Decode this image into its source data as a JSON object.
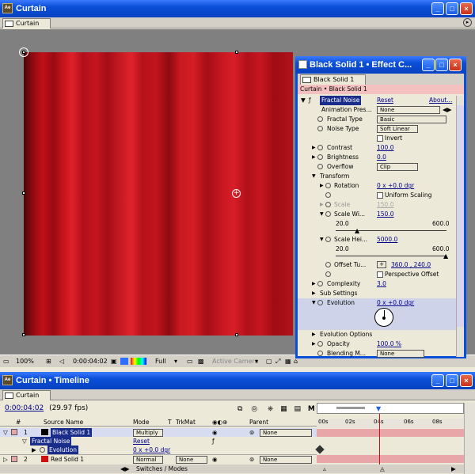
{
  "app": {
    "title": "Curtain",
    "tab": "Curtain"
  },
  "colors": {
    "titlebar": "#0a4fd8",
    "solid": "#c01018",
    "layer_bar": "#e8a6a8"
  },
  "comp_footer": {
    "zoom": "100%",
    "timecode": "0:00:04:02",
    "resolution": "Full",
    "camera": "Active Camera"
  },
  "effect_panel": {
    "title": "Black Solid 1 • Effect C...",
    "tab": "Black Solid 1",
    "breadcrumb": "Curtain • Black Solid 1",
    "effect_name": "Fractal Noise",
    "reset": "Reset",
    "about": "About...",
    "rows": [
      {
        "label": "Animation Pres...",
        "value": "None",
        "kind": "dropdown"
      },
      {
        "label": "Fractal Type",
        "value": "Basic",
        "kind": "dropdown"
      },
      {
        "label": "Noise Type",
        "value": "Soft Linear",
        "kind": "dropdown"
      },
      {
        "label": "",
        "value": "Invert",
        "kind": "check"
      },
      {
        "label": "Contrast",
        "value": "100.0",
        "kind": "num"
      },
      {
        "label": "Brightness",
        "value": "0.0",
        "kind": "num"
      },
      {
        "label": "Overflow",
        "value": "Clip",
        "kind": "dropdown"
      },
      {
        "label": "Transform",
        "value": "",
        "kind": "group"
      },
      {
        "label": "Rotation",
        "value": "0 x +0.0 dgr",
        "kind": "num"
      },
      {
        "label": "",
        "value": "Uniform Scaling",
        "kind": "check"
      },
      {
        "label": "Scale",
        "value": "150.0",
        "kind": "disabled"
      },
      {
        "label": "Scale Wi...",
        "value": "150.0",
        "kind": "num"
      },
      {
        "label": "Scale Hei...",
        "value": "5000.0",
        "kind": "num"
      },
      {
        "label": "Offset Tu...",
        "value": "360.0 , 240.0",
        "kind": "num"
      },
      {
        "label": "",
        "value": "Perspective Offset",
        "kind": "check"
      },
      {
        "label": "Complexity",
        "value": "3.0",
        "kind": "num"
      },
      {
        "label": "Sub Settings",
        "value": "",
        "kind": "group"
      },
      {
        "label": "Evolution",
        "value": "0 x +0.0 dgr",
        "kind": "num"
      },
      {
        "label": "Evolution Options",
        "value": "",
        "kind": "group"
      },
      {
        "label": "Opacity",
        "value": "100.0 %",
        "kind": "num"
      },
      {
        "label": "Blending M...",
        "value": "None",
        "kind": "dropdown"
      }
    ],
    "slider_w": {
      "min": "20.0",
      "max": "600.0",
      "level": 0.2
    },
    "slider_h": {
      "min": "20.0",
      "max": "600.0",
      "level": 1.0
    }
  },
  "timeline": {
    "title": "Curtain • Timeline",
    "tab": "Curtain",
    "time": "0:00:04:02",
    "fps": "(29.97 fps)",
    "columns": [
      "Source Name",
      "Mode",
      "T",
      "TrkMat",
      "Parent"
    ],
    "layers": [
      {
        "num": "1",
        "name": "Black Solid 1",
        "mode": "Multiply",
        "trkmat": "",
        "parent": "None"
      },
      {
        "num": "2",
        "name": "Red Solid 1",
        "mode": "Normal",
        "trkmat": "None",
        "parent": "None"
      }
    ],
    "sub_effect": "Fractal Noise",
    "sub_reset": "Reset",
    "evolution_label": "Evolution",
    "evolution_value": "0 x +0.0 dgr",
    "ruler": [
      "00s",
      "02s",
      "04s",
      "06s",
      "08s"
    ],
    "switches": "Switches / Modes"
  }
}
